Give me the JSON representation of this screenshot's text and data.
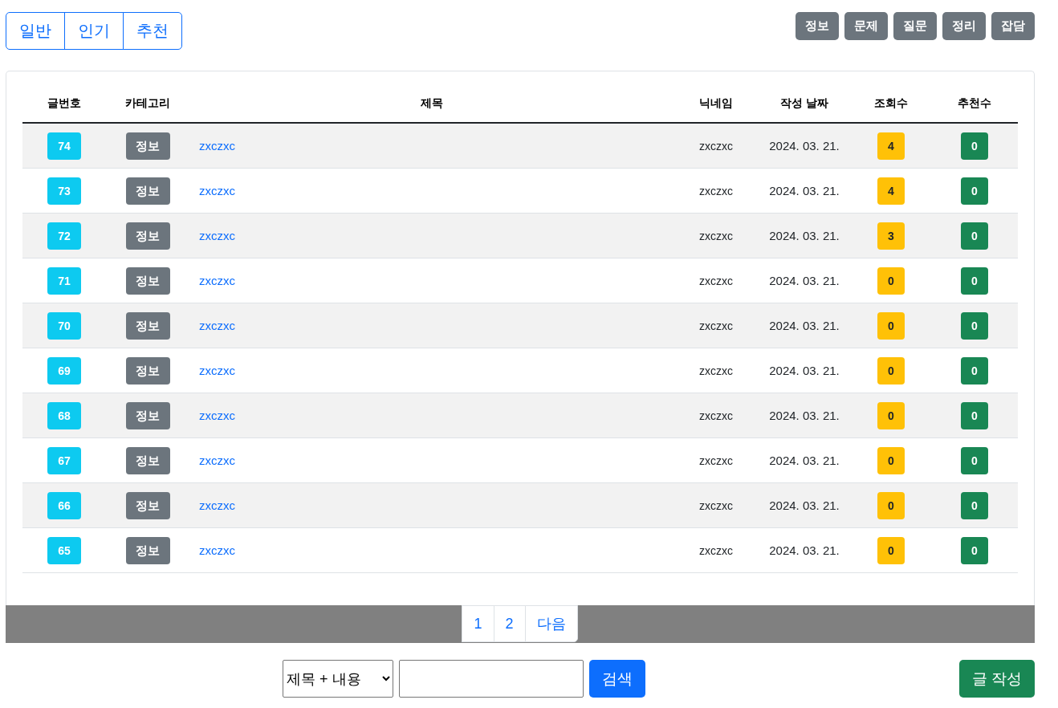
{
  "view_tabs": [
    {
      "label": "일반",
      "selected": false
    },
    {
      "label": "인기",
      "selected": false
    },
    {
      "label": "추천",
      "selected": false
    }
  ],
  "category_buttons": [
    "정보",
    "문제",
    "질문",
    "정리",
    "잡담"
  ],
  "table": {
    "columns": [
      "글번호",
      "카테고리",
      "제목",
      "닉네임",
      "작성 날짜",
      "조회수",
      "추천수"
    ],
    "rows": [
      {
        "number": "74",
        "category": "정보",
        "title": "zxczxc",
        "nickname": "zxczxc",
        "date": "2024. 03. 21.",
        "views": "4",
        "likes": "0"
      },
      {
        "number": "73",
        "category": "정보",
        "title": "zxczxc",
        "nickname": "zxczxc",
        "date": "2024. 03. 21.",
        "views": "4",
        "likes": "0"
      },
      {
        "number": "72",
        "category": "정보",
        "title": "zxczxc",
        "nickname": "zxczxc",
        "date": "2024. 03. 21.",
        "views": "3",
        "likes": "0"
      },
      {
        "number": "71",
        "category": "정보",
        "title": "zxczxc",
        "nickname": "zxczxc",
        "date": "2024. 03. 21.",
        "views": "0",
        "likes": "0"
      },
      {
        "number": "70",
        "category": "정보",
        "title": "zxczxc",
        "nickname": "zxczxc",
        "date": "2024. 03. 21.",
        "views": "0",
        "likes": "0"
      },
      {
        "number": "69",
        "category": "정보",
        "title": "zxczxc",
        "nickname": "zxczxc",
        "date": "2024. 03. 21.",
        "views": "0",
        "likes": "0"
      },
      {
        "number": "68",
        "category": "정보",
        "title": "zxczxc",
        "nickname": "zxczxc",
        "date": "2024. 03. 21.",
        "views": "0",
        "likes": "0"
      },
      {
        "number": "67",
        "category": "정보",
        "title": "zxczxc",
        "nickname": "zxczxc",
        "date": "2024. 03. 21.",
        "views": "0",
        "likes": "0"
      },
      {
        "number": "66",
        "category": "정보",
        "title": "zxczxc",
        "nickname": "zxczxc",
        "date": "2024. 03. 21.",
        "views": "0",
        "likes": "0"
      },
      {
        "number": "65",
        "category": "정보",
        "title": "zxczxc",
        "nickname": "zxczxc",
        "date": "2024. 03. 21.",
        "views": "0",
        "likes": "0"
      }
    ]
  },
  "pagination": [
    "1",
    "2",
    "다음"
  ],
  "search": {
    "scope": "제목 + 내용",
    "button": "검색"
  },
  "write_button": "글 작성"
}
